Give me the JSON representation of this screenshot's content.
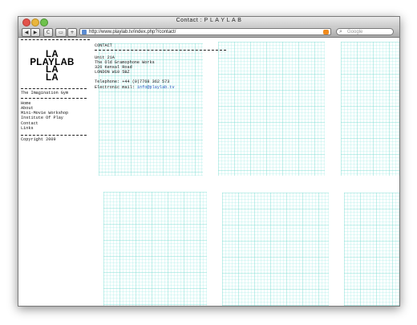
{
  "window": {
    "title": "Contact : P L A Y L A B"
  },
  "toolbar": {
    "back_glyph": "◀",
    "forward_glyph": "▶",
    "reload_glyph": "C",
    "add_glyph": "▭",
    "plus_glyph": "+",
    "url": "http://www.playlab.tv/index.php?/contact/",
    "search_placeholder": "Google"
  },
  "sidebar": {
    "logo_lines": [
      "LA",
      "PLAYLAB",
      "LA",
      "LA"
    ],
    "tagline": "The Imagination Gym",
    "nav": [
      "Home",
      "About",
      "Mini-Movie Workshop",
      "Institute Of Play",
      "Contact",
      "Links"
    ],
    "copyright": "Copyright 2009"
  },
  "content": {
    "heading": "CONTACT",
    "address": [
      "Unit 21A",
      "The Old Gramophone Works",
      "326 Kensal Road",
      "LONDON W10 5BZ"
    ],
    "telephone": "Telephone: +44 (0)7768 362 573",
    "email_label": "Electronic mail:",
    "email": "info@playlab.tv"
  },
  "colors": {
    "grid_line": "#78dcd2",
    "link": "#2255bb"
  }
}
